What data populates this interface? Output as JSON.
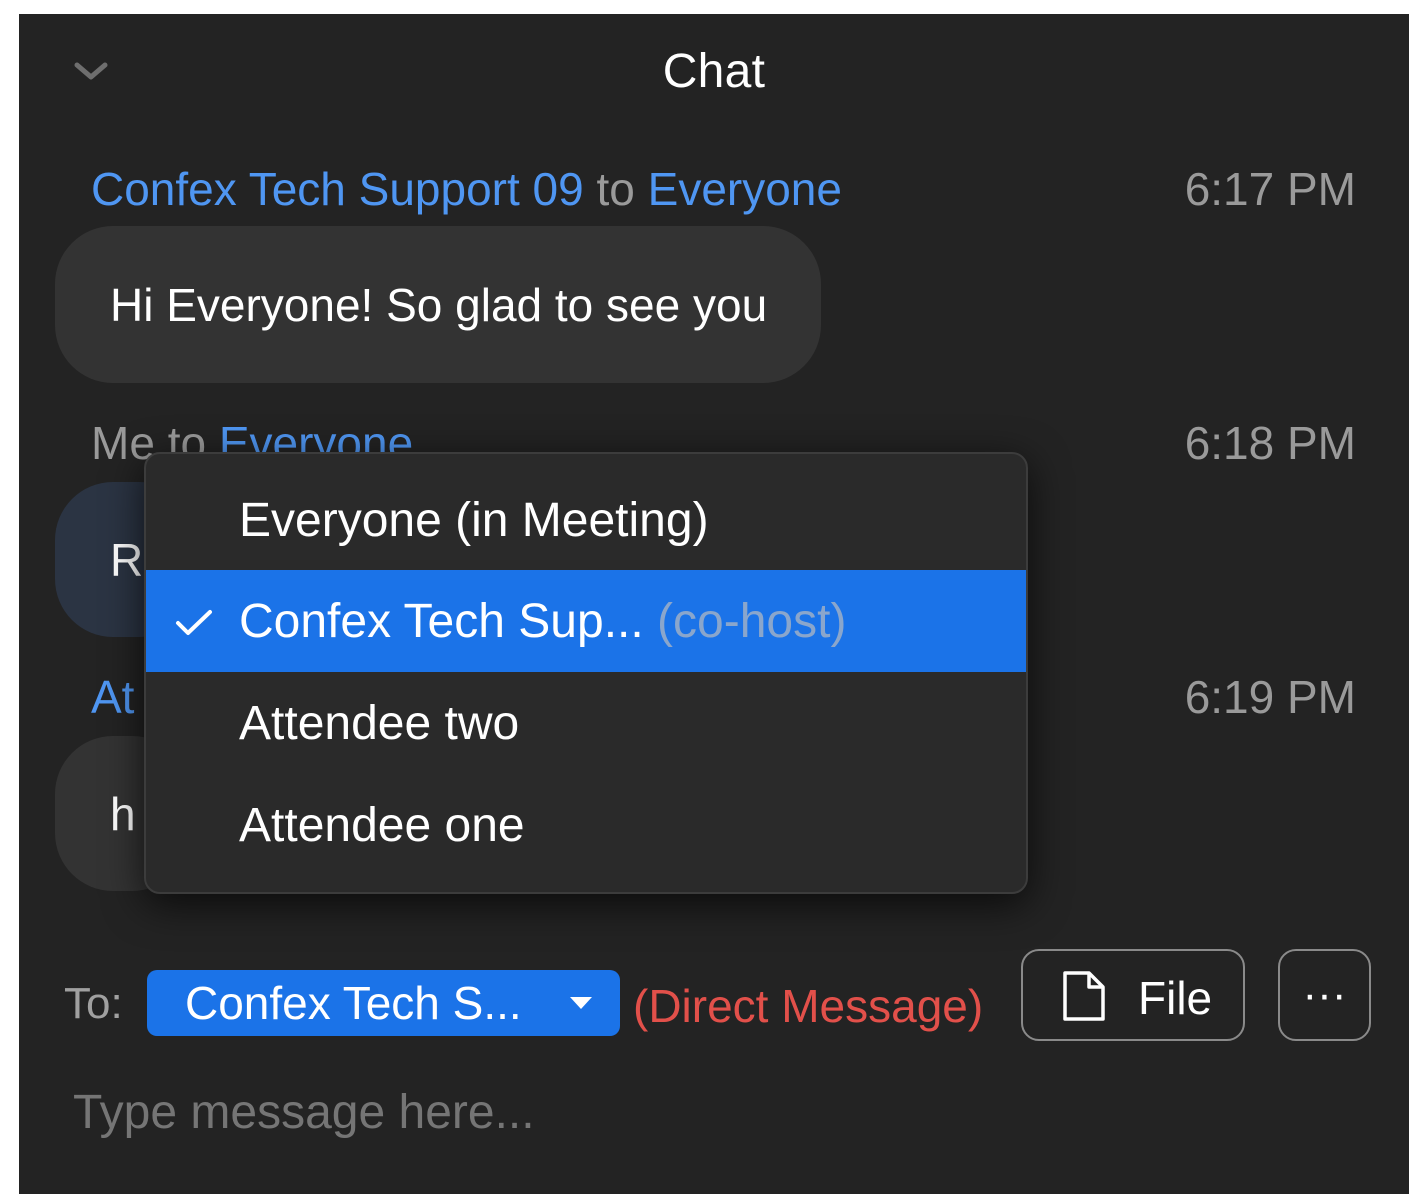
{
  "header": {
    "title": "Chat",
    "collapse_icon": "chevron-down-icon"
  },
  "messages": [
    {
      "sender": "Confex Tech Support 09",
      "connector": "to",
      "recipient": "Everyone",
      "time": "6:17 PM",
      "text": "Hi Everyone! So glad to see you"
    },
    {
      "sender": "Me",
      "connector": "to",
      "recipient": "Everyone",
      "time": "6:18 PM",
      "text": "R"
    },
    {
      "sender": "At",
      "time": "6:19 PM",
      "text": "h"
    }
  ],
  "recipient_menu": {
    "options": [
      {
        "label": "Everyone (in Meeting)",
        "suffix": "",
        "selected": false
      },
      {
        "label": "Confex Tech Sup...",
        "suffix": "(co-host)",
        "selected": true
      },
      {
        "label": "Attendee two",
        "suffix": "",
        "selected": false
      },
      {
        "label": "Attendee one",
        "suffix": "",
        "selected": false
      }
    ]
  },
  "composer": {
    "to_label": "To:",
    "recipient": "Confex Tech S...",
    "direct_message": "(Direct Message)",
    "file_label": "File",
    "more_label": "···",
    "placeholder": "Type message here..."
  },
  "colors": {
    "panel_bg": "#232323",
    "accent": "#1b73e8",
    "link_blue": "#4f96f2",
    "direct_message_red": "#e2504a"
  }
}
